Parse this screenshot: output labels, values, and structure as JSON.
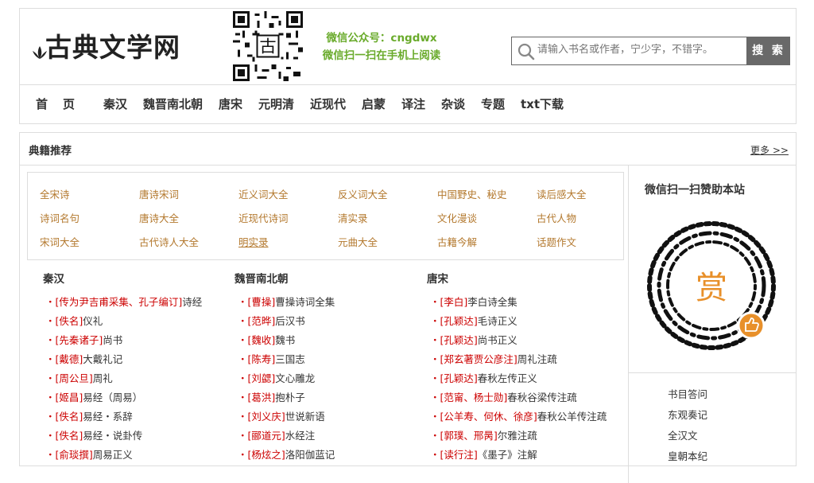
{
  "header": {
    "logo_text": "古典文学网",
    "wechat_line1": "微信公众号：cngdwx",
    "wechat_line2": "微信扫一扫在手机上阅读",
    "search_placeholder": "请输入书名或作者，宁少字，不错字。",
    "search_button": "搜 索"
  },
  "nav": [
    "首　页",
    "秦汉",
    "魏晋南北朝",
    "唐宋",
    "元明清",
    "近现代",
    "启蒙",
    "译注",
    "杂谈",
    "专题",
    "txt下载"
  ],
  "section": {
    "title": "典籍推荐",
    "more": "更多 >>"
  },
  "recommend": [
    [
      "全宋诗",
      "唐诗宋词",
      "近义词大全",
      "反义词大全",
      "中国野史、秘史",
      "读后感大全"
    ],
    [
      "诗词名句",
      "唐诗大全",
      "近现代诗词",
      "清实录",
      "文化漫谈",
      "古代人物"
    ],
    [
      "宋词大全",
      "古代诗人大全",
      "明实录",
      "元曲大全",
      "古籍今解",
      "话题作文"
    ]
  ],
  "columns": [
    {
      "title": "秦汉",
      "books": [
        {
          "author": "[传为尹吉甫采集、孔子编订]",
          "name": "诗经"
        },
        {
          "author": "[佚名]",
          "name": "仪礼"
        },
        {
          "author": "[先秦诸子]",
          "name": "尚书"
        },
        {
          "author": "[戴德]",
          "name": "大戴礼记"
        },
        {
          "author": "[周公旦]",
          "name": "周礼"
        },
        {
          "author": "[姬昌]",
          "name": "易经（周易）"
        },
        {
          "author": "[佚名]",
          "name": "易经・系辞"
        },
        {
          "author": "[佚名]",
          "name": "易经・说卦传"
        },
        {
          "author": "[俞琰撰]",
          "name": "周易正义"
        }
      ]
    },
    {
      "title": "魏晋南北朝",
      "books": [
        {
          "author": "[曹操]",
          "name": "曹操诗词全集"
        },
        {
          "author": "[范晔]",
          "name": "后汉书"
        },
        {
          "author": "[魏收]",
          "name": "魏书"
        },
        {
          "author": "[陈寿]",
          "name": "三国志"
        },
        {
          "author": "[刘勰]",
          "name": "文心雕龙"
        },
        {
          "author": "[葛洪]",
          "name": "抱朴子"
        },
        {
          "author": "[刘义庆]",
          "name": "世说新语"
        },
        {
          "author": "[郦道元]",
          "name": "水经注"
        },
        {
          "author": "[杨炫之]",
          "name": "洛阳伽蓝记"
        }
      ]
    },
    {
      "title": "唐宋",
      "books": [
        {
          "author": "[李白]",
          "name": "李白诗全集"
        },
        {
          "author": "[孔颖达]",
          "name": "毛诗正义"
        },
        {
          "author": "[孔颖达]",
          "name": "尚书正义"
        },
        {
          "author": "[郑玄著贾公彦注]",
          "name": "周礼注疏"
        },
        {
          "author": "[孔颖达]",
          "name": "春秋左传正义"
        },
        {
          "author": "[范甯、杨士勋]",
          "name": "春秋谷梁传注疏"
        },
        {
          "author": "[公羊寿、何休、徐彦]",
          "name": "春秋公羊传注疏"
        },
        {
          "author": "[郭璞、邢昺]",
          "name": "尔雅注疏"
        },
        {
          "author": "[读行注]",
          "name": "《墨子》注解"
        }
      ]
    }
  ],
  "sidebar": {
    "title": "微信扫一扫赞助本站",
    "zan_text": "赏",
    "links": [
      "书目答问",
      "东观奏记",
      "全汉文",
      "皇朝本纪"
    ]
  },
  "colors": {
    "accent_green": "#6aab2c",
    "recommend_link": "#b3782d",
    "author_red": "#cc0000",
    "search_button_bg": "#696969",
    "zan_orange": "#e8902a"
  }
}
